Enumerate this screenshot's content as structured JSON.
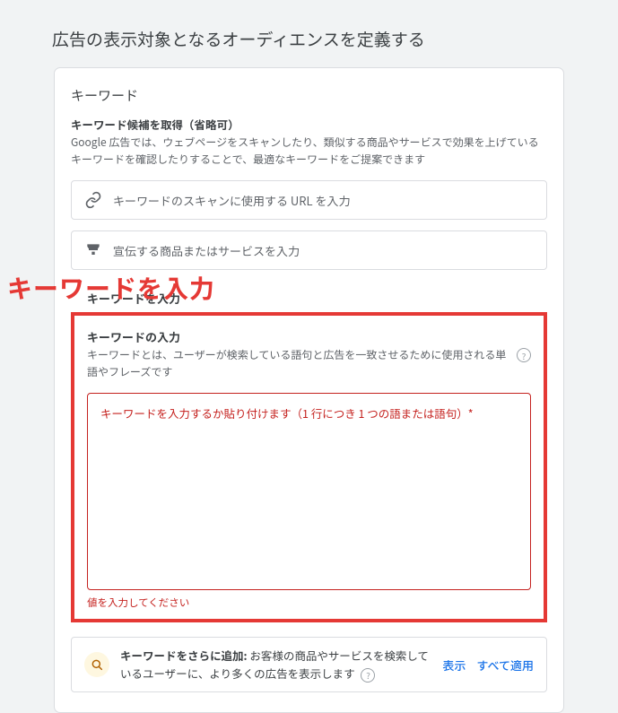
{
  "page": {
    "title": "広告の表示対象となるオーディエンスを定義する"
  },
  "keywords_section": {
    "heading": "キーワード",
    "suggestion": {
      "subheading": "キーワード候補を取得（省略可）",
      "description": "Google 広告では、ウェブページをスキャンしたり、類似する商品やサービスで効果を上げているキーワードを確認したりすることで、最適なキーワードをご提案できます",
      "url_input_placeholder": "キーワードのスキャンに使用する URL を入力",
      "product_input_placeholder": "宣伝する商品またはサービスを入力"
    },
    "divider_label": "キーワードを入力"
  },
  "annotation": {
    "label": "キーワードを入力"
  },
  "keyword_input": {
    "heading": "キーワードの入力",
    "description": "キーワードとは、ユーザーが検索している語句と広告を一致させるために使用される単語やフレーズです",
    "textarea_placeholder": "キーワードを入力するか貼り付けます（1 行につき 1 つの語または語句）*",
    "error": "値を入力してください"
  },
  "more_keywords": {
    "bold_prefix": "キーワードをさらに追加:",
    "text": " お客様の商品やサービスを検索しているユーザーに、より多くの広告を表示します",
    "show_button": "表示",
    "apply_all_button": "すべて適用"
  }
}
